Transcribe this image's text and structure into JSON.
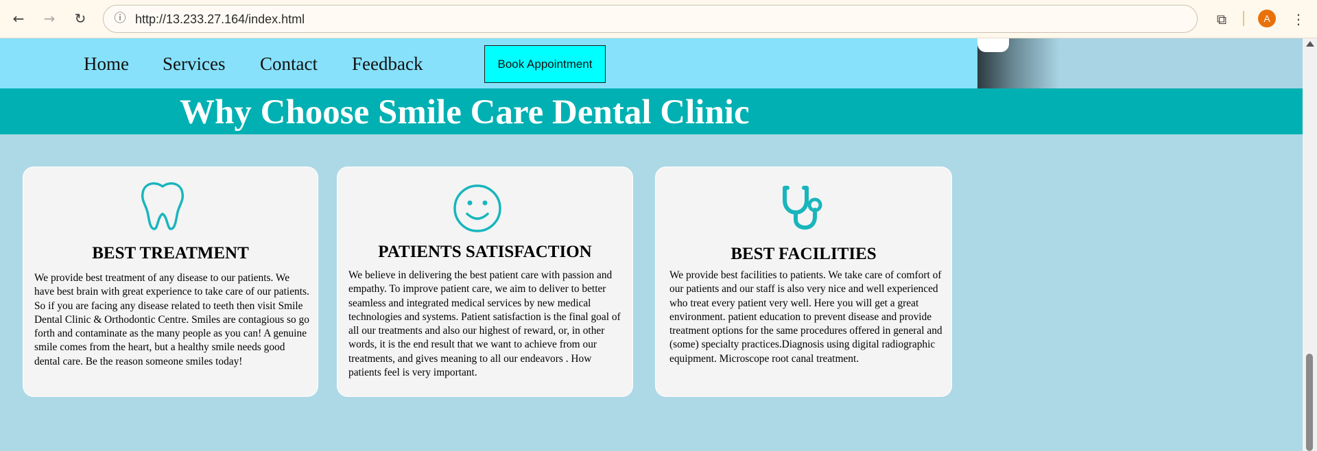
{
  "browser": {
    "url": "http://13.233.27.164/index.html",
    "profile_initial": "A",
    "accent_color": "#e8710a"
  },
  "nav": {
    "links": [
      "Home",
      "Services",
      "Contact",
      "Feedback"
    ],
    "book_button": "Book Appointment",
    "bg_color": "#87e1fb",
    "button_color": "#00ffff"
  },
  "banner": {
    "title": "Why Choose Smile Care Dental Clinic",
    "bg_color": "#00b0b2"
  },
  "cards": [
    {
      "icon": "tooth-icon",
      "title": "BEST TREATMENT",
      "text": "We provide best treatment of any disease to our patients. We have best brain with great experience to take care of our patients. So if you  are facing any disease related to teeth then visit Smile Dental Clinic & Orthodontic Centre. Smiles are contagious so go forth and contaminate as the many people as you can! A genuine smile comes from the heart, but a healthy smile needs good dental care. Be the reason someone smiles today!"
    },
    {
      "icon": "smiley-icon",
      "title": "PATIENTS SATISFACTION",
      "text": "We believe in delivering the best patient care with passion and empathy. To improve patient care, we  aim to deliver to better seamless and integrated medical services by new medical technologies and systems. Patient  satisfaction is the final goal of all our treatments and also our highest of reward, or, in other words, it is the end result that we want to achieve from our treatments, and gives  meaning to all our endeavors . How patients feel is very important."
    },
    {
      "icon": "stethoscope-icon",
      "title": "BEST FACILITIES",
      "text": "We  provide best  facilities to patients. We take care of comfort  of our patients and our  staff is also very nice and well experienced who treat every patient very well. Here you will get a great environment. patient education to prevent disease and provide  treatment options for the same procedures offered in general and (some) specialty practices.Diagnosis using digital radiographic equipment. Microscope root canal treatment."
    }
  ],
  "theme": {
    "page_bg": "#add8e6",
    "icon_color": "#19b5bd",
    "card_bg": "#f4f4f4"
  }
}
